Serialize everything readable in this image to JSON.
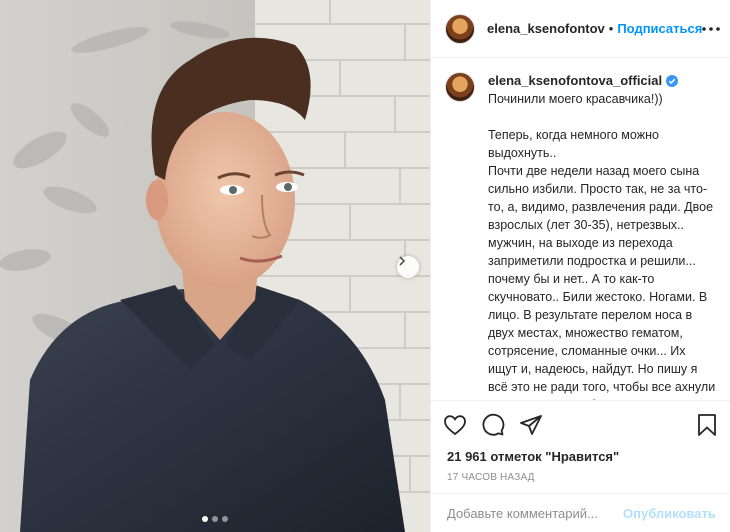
{
  "post": {
    "username": "elena_ksenofontov",
    "separator": "•",
    "follow_label": "Подписаться",
    "caption_user": "elena_ksenofontova_official",
    "caption_lines": [
      "Починили моего красавчика!))",
      "",
      "Теперь, когда немного можно выдохнуть..",
      "Почти две недели назад моего сына сильно избили. Просто так, не за что-то, а, видимо, развлечения ради. Двое взрослых (лет 30-35), нетрезвых.. мужчин, на выходе из перехода заприметили подростка и решили... почему бы и нет.. А то как-то скучновато.. Били жестоко. Ногами. В лицо. В результате перелом носа в двух местах, множество гематом, сотрясение, сломанные очки... Их ищут и, надеюсь, найдут. Но пишу я всё это не ради того, чтобы все ахнули и пожалели, а из благодарности"
    ],
    "likes": "21 961 отметок \"Нравится\"",
    "time": "17 ЧАСОВ НАЗАД",
    "comment_placeholder": "Добавьте комментарий...",
    "publish_label": "Опубликовать"
  },
  "carousel": {
    "count": 3,
    "active": 0
  },
  "icons": {
    "more": "more-icon",
    "like": "heart-icon",
    "comment": "comment-icon",
    "share": "share-icon",
    "save": "bookmark-icon",
    "next": "chevron-right-icon",
    "verified": "verified-badge-icon"
  },
  "colors": {
    "follow": "#0095f6",
    "publish_disabled": "#b2dffc",
    "verified": "#3897f0",
    "muted": "#8e8e8e"
  }
}
